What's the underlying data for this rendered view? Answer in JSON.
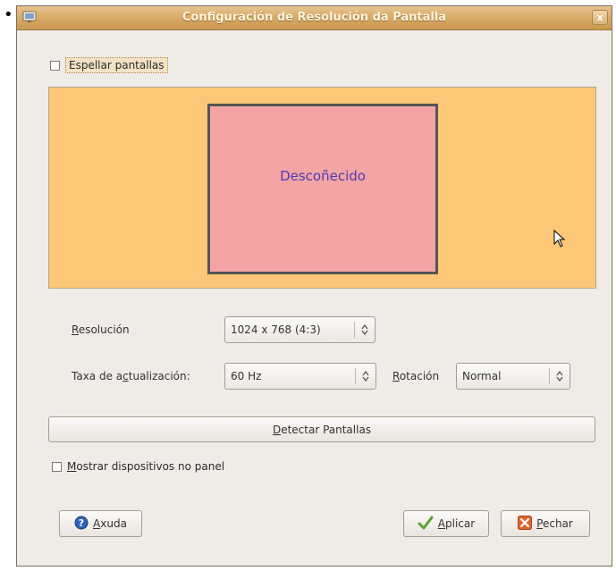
{
  "window": {
    "title": "Configuración de Resolución da Pantalla",
    "close_glyph": "x"
  },
  "mirror_screens": {
    "label": "Espellar pantallas",
    "checked": false
  },
  "display": {
    "monitor_label": "Descoñecido"
  },
  "resolution": {
    "label_accel": "R",
    "label_rest": "esolución",
    "value": "1024 x 768 (4:3)"
  },
  "refresh_rate": {
    "label_pre": "Taxa de a",
    "label_accel": "c",
    "label_post": "tualización:",
    "value": "60 Hz"
  },
  "rotation": {
    "label_pre": "R",
    "label_accel": "o",
    "label_post": "tación",
    "value": "Normal"
  },
  "detect_button": {
    "label_accel": "D",
    "label_rest": "etectar Pantallas"
  },
  "show_in_panel": {
    "label_accel": "M",
    "label_rest": "ostrar dispositivos no panel",
    "checked": false
  },
  "help_button": {
    "label_accel": "A",
    "label_rest": "xuda",
    "icon": "help-icon"
  },
  "apply_button": {
    "label_accel": "A",
    "label_rest": "plicar",
    "icon": "checkmark-icon"
  },
  "close_button": {
    "label_accel": "P",
    "label_rest": "echar",
    "icon": "close-icon"
  },
  "colors": {
    "titlebar": "#d6a863",
    "display_area": "#fcc877",
    "monitor": "#f4a4a4",
    "monitor_label": "#4d3bb4"
  }
}
